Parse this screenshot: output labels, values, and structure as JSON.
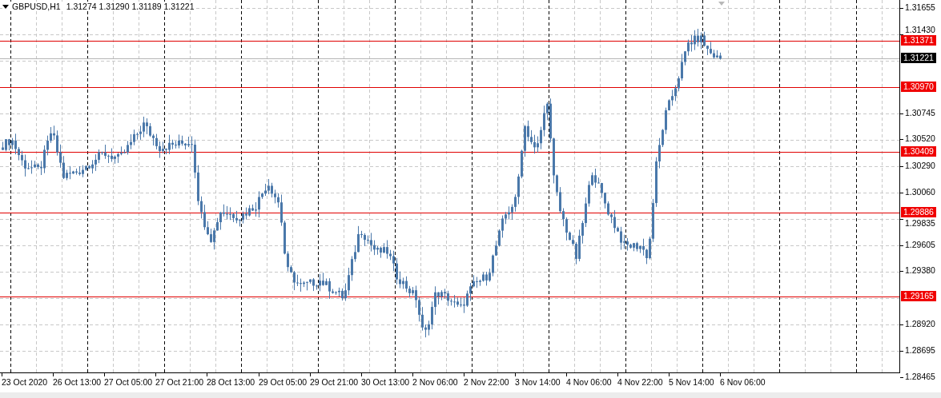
{
  "chart_header": {
    "symbol": "GBPUSD,H1",
    "ohlc": "1.31274 1.31290 1.31189 1.31221"
  },
  "price_axis": [
    "1.31655",
    "1.31430",
    "1.30745",
    "1.30520",
    "1.30290",
    "1.30060",
    "1.29835",
    "1.29605",
    "1.29380",
    "1.28920",
    "1.28695",
    "1.28465"
  ],
  "price_lines": [
    {
      "kind": "level",
      "price": "1.31371"
    },
    {
      "kind": "bid",
      "price": "1.31221"
    },
    {
      "kind": "level",
      "price": "1.30970"
    },
    {
      "kind": "level",
      "price": "1.30409"
    },
    {
      "kind": "level",
      "price": "1.29886"
    },
    {
      "kind": "level",
      "price": "1.29165"
    }
  ],
  "time_axis": [
    "23 Oct 2020",
    "26 Oct 13:00",
    "27 Oct 05:00",
    "27 Oct 21:00",
    "28 Oct 13:00",
    "29 Oct 05:00",
    "29 Oct 21:00",
    "30 Oct 13:00",
    "2 Nov 06:00",
    "2 Nov 22:00",
    "3 Nov 14:00",
    "4 Nov 06:00",
    "4 Nov 22:00",
    "5 Nov 14:00",
    "6 Nov 06:00"
  ]
}
